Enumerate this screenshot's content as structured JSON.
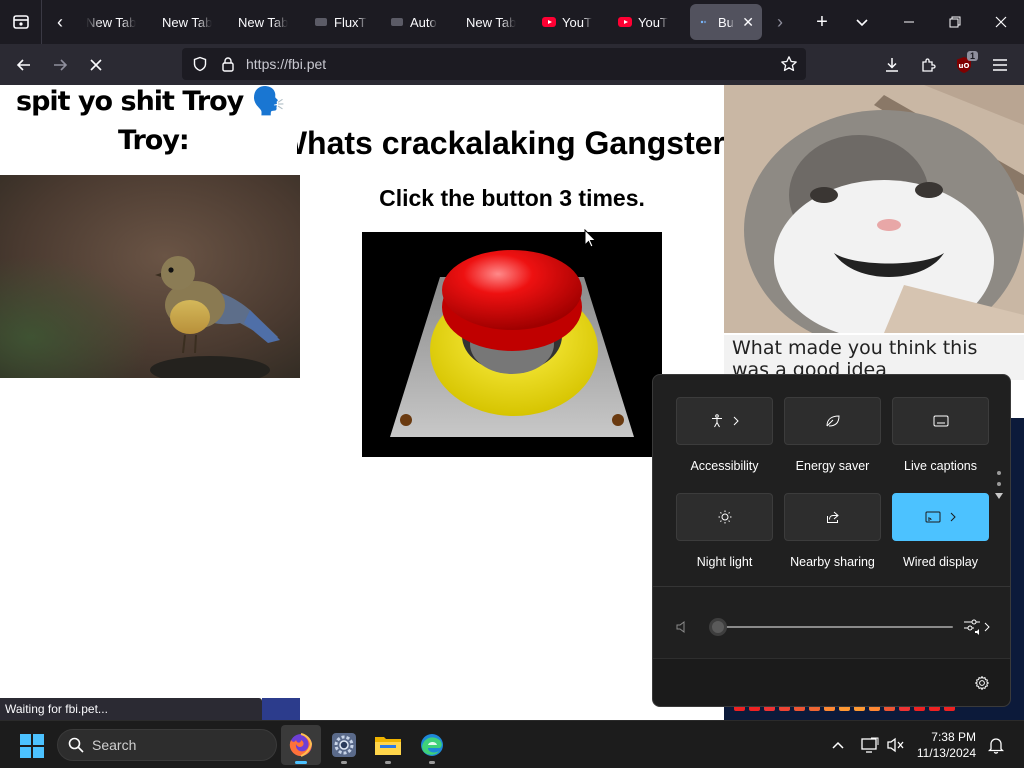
{
  "browser": {
    "tabs": [
      {
        "title": "New Tab",
        "favicon": "none"
      },
      {
        "title": "New Tab",
        "favicon": "none"
      },
      {
        "title": "New Tab",
        "favicon": "none"
      },
      {
        "title": "FluxT",
        "favicon": "generic"
      },
      {
        "title": "Auto",
        "favicon": "generic"
      },
      {
        "title": "New Tab",
        "favicon": "none"
      },
      {
        "title": "YouT",
        "favicon": "youtube"
      },
      {
        "title": "YouT",
        "favicon": "youtube"
      },
      {
        "title": "Bu",
        "favicon": "loading",
        "active": true
      }
    ],
    "url": "https://fbi.pet",
    "extension_badge": "1",
    "status_text": "Waiting for fbi.pet..."
  },
  "page": {
    "troy_line1": "spit yo shit Troy 🗣️",
    "troy_line2": "Troy:",
    "headline": "Whats crackalaking Gangster",
    "instruction": "Click the button 3 times.",
    "cat_caption": "What made you think this was a good idea"
  },
  "quick_settings": {
    "tiles": [
      {
        "label": "Accessibility",
        "icon": "accessibility-icon",
        "has_arrow": true,
        "active": false
      },
      {
        "label": "Energy saver",
        "icon": "leaf-icon",
        "has_arrow": false,
        "active": false
      },
      {
        "label": "Live captions",
        "icon": "captions-icon",
        "has_arrow": false,
        "active": false
      },
      {
        "label": "Night light",
        "icon": "sun-icon",
        "has_arrow": false,
        "active": false
      },
      {
        "label": "Nearby sharing",
        "icon": "share-icon",
        "has_arrow": false,
        "active": false
      },
      {
        "label": "Wired display",
        "icon": "cast-icon",
        "has_arrow": true,
        "active": true
      }
    ],
    "volume_level": 0,
    "accent_color": "#4cc2ff"
  },
  "taskbar": {
    "search_placeholder": "Search",
    "time": "7:38 PM",
    "date": "11/13/2024",
    "apps": [
      "firefox-icon",
      "settings-icon",
      "file-explorer-icon",
      "edge-icon"
    ]
  }
}
